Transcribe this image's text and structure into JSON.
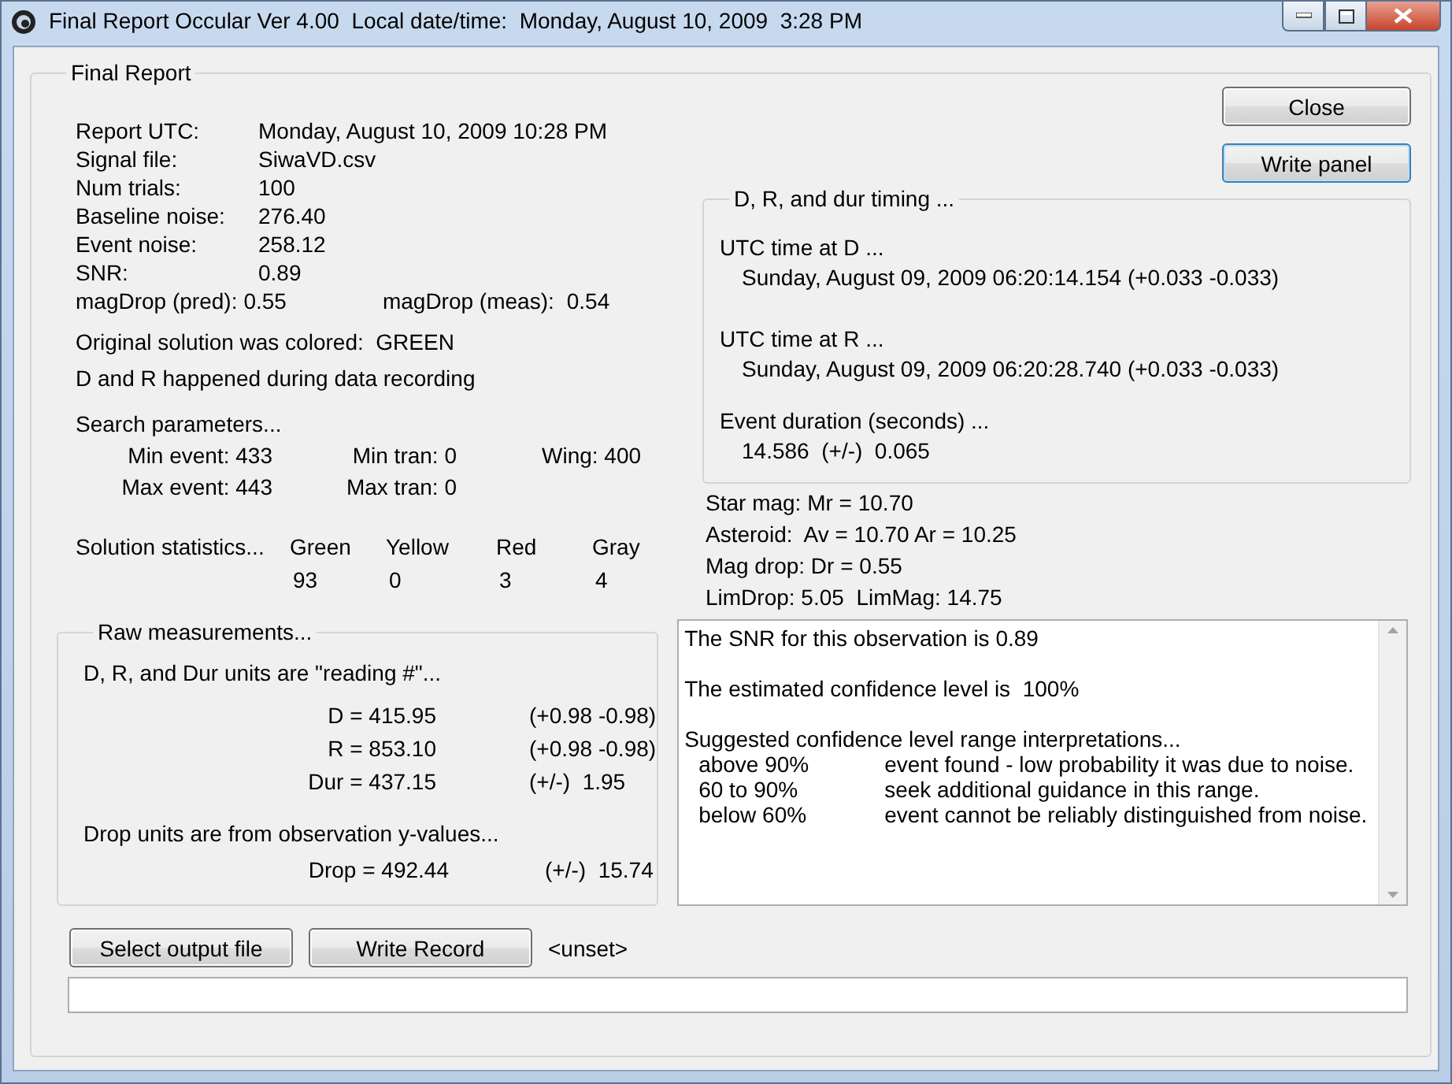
{
  "window": {
    "title": "Final Report Occular Ver 4.00  Local date/time:  Monday, August 10, 2009  3:28 PM"
  },
  "group_title": "Final Report",
  "buttons": {
    "close": "Close",
    "write_panel": "Write panel"
  },
  "report_fields": [
    {
      "label": "Report UTC:",
      "value": "Monday, August 10, 2009 10:28 PM"
    },
    {
      "label": "Signal file:",
      "value": "SiwaVD.csv"
    },
    {
      "label": "Num trials:",
      "value": "100"
    },
    {
      "label": "Baseline noise:",
      "value": "276.40"
    },
    {
      "label": "Event noise:",
      "value": "258.12"
    },
    {
      "label": "SNR:",
      "value": "0.89"
    }
  ],
  "mag_drop": [
    {
      "label": "magDrop (pred):",
      "value": "0.55"
    },
    {
      "label": "magDrop (meas):",
      "value": "0.54"
    }
  ],
  "solution_notes": [
    "Original solution was colored:  GREEN",
    "D and R happened during data recording"
  ],
  "search_parameters": {
    "title": "Search parameters...",
    "rows": [
      {
        "items": [
          "Min event: 433",
          "Min tran: 0",
          "Wing: 400"
        ]
      },
      {
        "items": [
          "Max event: 443",
          "Max tran: 0"
        ]
      }
    ]
  },
  "solution_statistics": {
    "title": "Solution statistics...",
    "columns": [
      {
        "name": "Green",
        "count": "93"
      },
      {
        "name": "Yellow",
        "count": "0"
      },
      {
        "name": "Red",
        "count": "3"
      },
      {
        "name": "Gray",
        "count": "4"
      }
    ]
  },
  "timing": {
    "title": "D, R, and dur timing ...",
    "sections": [
      {
        "heading": "UTC time at D ...",
        "value": "Sunday, August 09, 2009 06:20:14.154 (+0.033 -0.033)"
      },
      {
        "heading": "UTC time at R ...",
        "value": "Sunday, August 09, 2009 06:20:28.740 (+0.033 -0.033)"
      },
      {
        "heading": "Event duration (seconds) ...",
        "value": "14.586  (+/-)  0.065"
      }
    ]
  },
  "magnitudes": [
    "Star mag: Mr = 10.70",
    "Asteroid:  Av = 10.70 Ar = 10.25",
    "Mag drop: Dr = 0.55",
    "LimDrop: 5.05  LimMag: 14.75"
  ],
  "raw_measurements": {
    "title": "Raw measurements...",
    "units_note": "D, R, and Dur units are \"reading #\"...",
    "rows": [
      {
        "label": "D = 415.95",
        "error": "(+0.98 -0.98)"
      },
      {
        "label": "R = 853.10",
        "error": "(+0.98 -0.98)"
      },
      {
        "label": "Dur = 437.15",
        "error": "(+/-)  1.95"
      }
    ],
    "drop_note": "Drop units are from observation y-values...",
    "drop": {
      "label": "Drop = 492.44",
      "error": "(+/-)  15.74"
    }
  },
  "report_text": {
    "snr_line": "The SNR for this observation is 0.89",
    "confidence_line": "The estimated confidence level is  100%",
    "interpretations_title": "Suggested confidence level range interpretations...",
    "interpretations": [
      {
        "range": "above 90%",
        "meaning": "event found - low probability it was due to noise."
      },
      {
        "range": "60 to 90%",
        "meaning": "seek additional guidance in this range."
      },
      {
        "range": "below 60%",
        "meaning": "event cannot be reliably distinguished from noise."
      }
    ]
  },
  "output": {
    "select_button": "Select output file",
    "write_button": "Write Record",
    "file": "<unset>"
  }
}
